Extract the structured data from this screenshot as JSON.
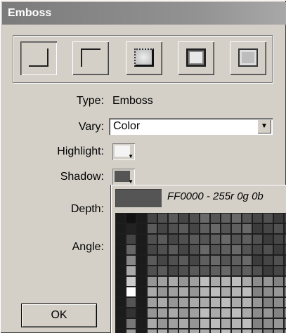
{
  "window": {
    "title": "Emboss"
  },
  "styles": [
    {
      "name": "emboss-style-1",
      "selected": true
    },
    {
      "name": "emboss-style-2",
      "selected": false
    },
    {
      "name": "emboss-style-3",
      "selected": false
    },
    {
      "name": "emboss-style-4",
      "selected": false
    },
    {
      "name": "emboss-style-5",
      "selected": false
    }
  ],
  "fields": {
    "type_label": "Type:",
    "type_value": "Emboss",
    "vary_label": "Vary:",
    "vary_value": "Color",
    "highlight_label": "Highlight:",
    "shadow_label": "Shadow:",
    "depth_label": "Depth:",
    "angle_label": "Angle:"
  },
  "colors": {
    "highlight": "#f4f4f4",
    "shadow": "#555555",
    "accent": "#555555"
  },
  "picker": {
    "current_text": "FF0000 - 255r 0g 0b"
  },
  "buttons": {
    "ok": "OK"
  }
}
